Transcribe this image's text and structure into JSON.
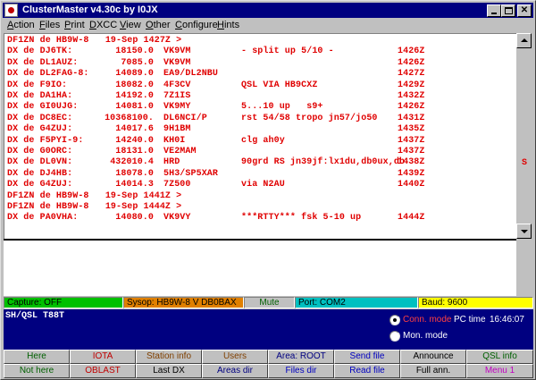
{
  "titlebar": {
    "title": "ClusterMaster v4.30c by I0JX"
  },
  "menu": [
    {
      "label": "Action",
      "u": "A",
      "rest": "ction"
    },
    {
      "label": "Files",
      "u": "F",
      "rest": "iles"
    },
    {
      "label": "Print",
      "u": "P",
      "rest": "rint"
    },
    {
      "label": "DXCC",
      "u": "D",
      "rest": "XCC"
    },
    {
      "label": "View",
      "u": "V",
      "rest": "iew"
    },
    {
      "label": "Other",
      "u": "O",
      "rest": "ther"
    },
    {
      "label": "Configure",
      "u": "C",
      "rest": "onfigure"
    },
    {
      "label": "Hints",
      "u": "H",
      "rest": "ints"
    }
  ],
  "spots": [
    {
      "a": "DF1ZN de HB9W-8   19-Sep 1427Z >",
      "b": "",
      "c": "",
      "d": "",
      "e": ""
    },
    {
      "a": "DX de DJ6TK:",
      "b": "18150.0",
      "c": "VK9VM",
      "d": "- split up 5/10 -",
      "e": "1426Z"
    },
    {
      "a": "DX de DL1AUZ:",
      "b": "7085.0",
      "c": "VK9VM",
      "d": "",
      "e": "1426Z"
    },
    {
      "a": "DX de DL2FAG-8:",
      "b": "14089.0",
      "c": "EA9/DL2NBU",
      "d": "",
      "e": "1427Z"
    },
    {
      "a": "DX de F9IO:",
      "b": "18082.0",
      "c": "4F3CV",
      "d": "QSL VIA HB9CXZ",
      "e": "1429Z"
    },
    {
      "a": "DX de DA1HA:",
      "b": "14192.0",
      "c": "7Z1IS",
      "d": "",
      "e": "1432Z"
    },
    {
      "a": "DX de GI0UJG:",
      "b": "14081.0",
      "c": "VK9MY",
      "d": "5...10 up   s9+",
      "e": "1426Z"
    },
    {
      "a": "DX de DC8EC:",
      "b": "10368100.",
      "c": "DL6NCI/P",
      "d": "rst 54/58 tropo jn57/jo50",
      "e": "1431Z"
    },
    {
      "a": "DX de G4ZUJ:",
      "b": "14017.6",
      "c": "9H1BM",
      "d": "",
      "e": "1435Z"
    },
    {
      "a": "DX de F5PYI-9:",
      "b": "14240.0",
      "c": "KH0I",
      "d": "clg ah0y",
      "e": "1437Z"
    },
    {
      "a": "DX de G0ORC:",
      "b": "18131.0",
      "c": "VE2MAM",
      "d": "",
      "e": "1437Z"
    },
    {
      "a": "DX de DL0VN:",
      "b": "432010.4",
      "c": "HRD",
      "d": "90grd RS jn39jf:lx1du,db0ux,db",
      "e": "1438Z"
    },
    {
      "a": "DX de DJ4HB:",
      "b": "18078.0",
      "c": "5H3/SP5XAR",
      "d": "",
      "e": "1439Z"
    },
    {
      "a": "DX de G4ZUJ:",
      "b": "14014.3",
      "c": "7Z500",
      "d": "via N2AU",
      "e": "1440Z"
    },
    {
      "a": "DF1ZN de HB9W-8   19-Sep 1441Z >",
      "b": "",
      "c": "",
      "d": "",
      "e": ""
    },
    {
      "a": "DF1ZN de HB9W-8   19-Sep 1444Z >",
      "b": "",
      "c": "",
      "d": "",
      "e": ""
    },
    {
      "a": "DX de PA0VHA:",
      "b": "14080.0",
      "c": "VK9VY",
      "d": "***RTTY*** fsk 5-10 up",
      "e": "1444Z"
    }
  ],
  "scroll_marker": "S",
  "status": {
    "capture": "Capture: OFF",
    "sysop": "Sysop: HB9W-8 V DB0BAX",
    "mute": "Mute",
    "port": "Port: COM2",
    "baud": "Baud: 9600"
  },
  "command_text": "SH/QSL T88T",
  "modes": {
    "conn_label": "Conn. mode",
    "mon_label": "Mon. mode",
    "pc_time_label": "PC time",
    "pc_time": "16:46:07"
  },
  "buttons_row1": [
    {
      "label": "Here",
      "color": "#006000"
    },
    {
      "label": "IOTA",
      "color": "#c00000"
    },
    {
      "label": "Station info",
      "color": "#804000"
    },
    {
      "label": "Users",
      "color": "#804000"
    },
    {
      "label": "Area: ROOT",
      "color": "#000080"
    },
    {
      "label": "Send file",
      "color": "#0000c0"
    },
    {
      "label": "Announce",
      "color": "#000000"
    },
    {
      "label": "QSL info",
      "color": "#006000"
    }
  ],
  "buttons_row2": [
    {
      "label": "Not here",
      "color": "#006000"
    },
    {
      "label": "OBLAST",
      "color": "#c00000"
    },
    {
      "label": "Last DX",
      "color": "#000000"
    },
    {
      "label": "Areas dir",
      "color": "#000080"
    },
    {
      "label": "Files dir",
      "color": "#0000c0"
    },
    {
      "label": "Read file",
      "color": "#0000c0"
    },
    {
      "label": "Full ann.",
      "color": "#000000"
    },
    {
      "label": "Menu 1",
      "color": "#c000c0"
    }
  ],
  "colors": {
    "spot_text": "#e00000",
    "capture_bg": "#00c000",
    "sysop_bg": "#e08000",
    "mute_bg": "#c0c0c0",
    "port_bg": "#00c0c0",
    "baud_bg": "#ffff00",
    "cmd_bg": "#000080",
    "conn_label": "#ff4040",
    "mon_label": "#ffffff"
  }
}
